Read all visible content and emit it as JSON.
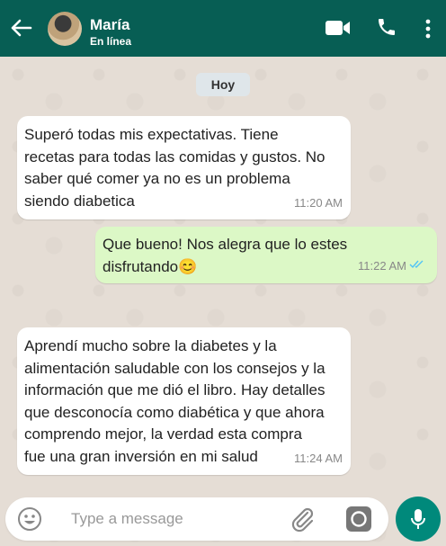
{
  "header": {
    "contact_name": "María",
    "status": "En línea",
    "back_icon": "arrow-left-icon",
    "video_icon": "video-camera-icon",
    "call_icon": "phone-icon",
    "menu_icon": "more-vertical-icon"
  },
  "chat": {
    "day_label": "Hoy",
    "messages": [
      {
        "direction": "incoming",
        "text": "Superó todas mis expectativas. Tiene\nrecetas para todas las comidas y gustos. No\nsaber qué comer ya no es un problema\nsiendo diabetica",
        "time": "11:20 AM"
      },
      {
        "direction": "outgoing",
        "text": "Que bueno! Nos alegra que lo estes\ndisfrutando😊",
        "time": "11:22 AM",
        "read": true
      },
      {
        "direction": "incoming",
        "text": "Aprendí mucho sobre la diabetes y la\nalimentación saludable con los consejos y la\ninformación que me dió el libro. Hay detalles\nque desconocía como diabética y que ahora\ncomprendo mejor, la verdad esta compra\nfue una gran inversión en mi salud",
        "time": "11:24 AM"
      }
    ]
  },
  "composer": {
    "placeholder": "Type a message",
    "emoji_icon": "emoji-icon",
    "attach_icon": "paperclip-icon",
    "camera_icon": "camera-icon",
    "mic_icon": "microphone-icon"
  },
  "colors": {
    "header_bg": "#075e54",
    "chat_bg": "#e5ddd5",
    "outgoing_bubble": "#dcf8c6",
    "incoming_bubble": "#ffffff",
    "mic_button": "#00897b",
    "read_ticks": "#4fc3f7"
  }
}
